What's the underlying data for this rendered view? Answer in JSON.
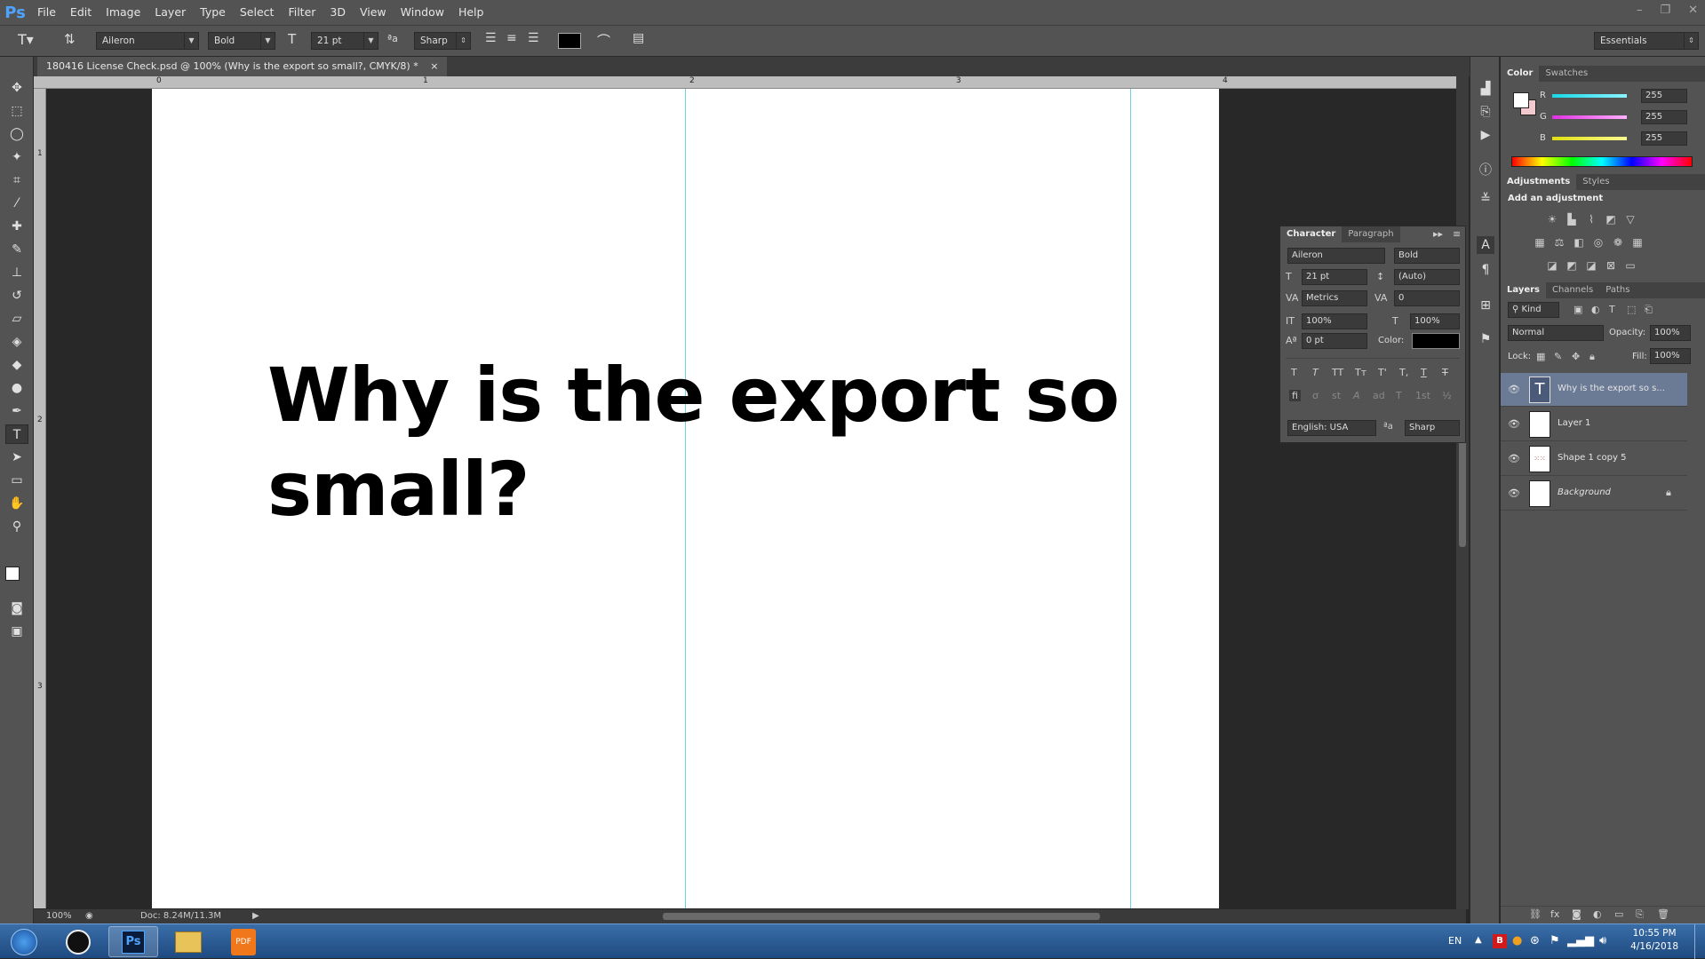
{
  "app": {
    "logo": "Ps",
    "menu": [
      "File",
      "Edit",
      "Image",
      "Layer",
      "Type",
      "Select",
      "Filter",
      "3D",
      "View",
      "Window",
      "Help"
    ],
    "window_controls": [
      "–",
      "❐",
      "✕"
    ]
  },
  "options_bar": {
    "font_family": "Aileron",
    "font_style": "Bold",
    "font_size": "21 pt",
    "antialias": "Sharp",
    "workspace": "Essentials",
    "text_color": "#000000"
  },
  "document": {
    "tab_title": "180416 License Check.psd @ 100% (Why is the export so small?, CMYK/8) *",
    "tab_close": "×",
    "ruler_h": [
      "0",
      "1",
      "2",
      "3",
      "4"
    ],
    "ruler_v": [
      "1",
      "2",
      "3"
    ],
    "headline": "Why is the export so small?",
    "zoom": "100%",
    "doc_info": "Doc: 8.24M/11.3M"
  },
  "character_panel": {
    "tabs": [
      "Character",
      "Paragraph"
    ],
    "font_family": "Aileron",
    "font_style": "Bold",
    "size": "21 pt",
    "leading": "(Auto)",
    "kerning": "Metrics",
    "tracking": "0",
    "vertical_scale": "100%",
    "horizontal_scale": "100%",
    "baseline_shift": "0 pt",
    "color_label": "Color:",
    "style_buttons": [
      "T",
      "T",
      "TT",
      "Tт",
      "T'",
      "T,",
      "T",
      "T"
    ],
    "ot_buttons": [
      "fi",
      "ơ",
      "st",
      "A",
      "ad",
      "T",
      "1st",
      "½"
    ],
    "language": "English: USA",
    "antialias": "Sharp"
  },
  "color_panel": {
    "tabs": [
      "Color",
      "Swatches"
    ],
    "channels": [
      {
        "label": "R",
        "value": "255",
        "color": "#1de1f0"
      },
      {
        "label": "G",
        "value": "255",
        "color": "#e838e8"
      },
      {
        "label": "B",
        "value": "255",
        "color": "#e8e82c"
      }
    ]
  },
  "adjustments_panel": {
    "tabs": [
      "Adjustments",
      "Styles"
    ],
    "title": "Add an adjustment"
  },
  "layers_panel": {
    "tabs": [
      "Layers",
      "Channels",
      "Paths"
    ],
    "filter": "Kind",
    "blend_mode": "Normal",
    "opacity_label": "Opacity:",
    "opacity": "100%",
    "lock_label": "Lock:",
    "fill_label": "Fill:",
    "fill": "100%",
    "layers": [
      {
        "name": "Why is the export so s...",
        "selected": true
      },
      {
        "name": "Layer 1",
        "selected": false
      },
      {
        "name": "Shape 1 copy 5",
        "selected": false
      },
      {
        "name": "Background",
        "selected": false
      }
    ]
  },
  "taskbar": {
    "language": "EN",
    "time": "10:55 PM",
    "date": "4/16/2018"
  }
}
